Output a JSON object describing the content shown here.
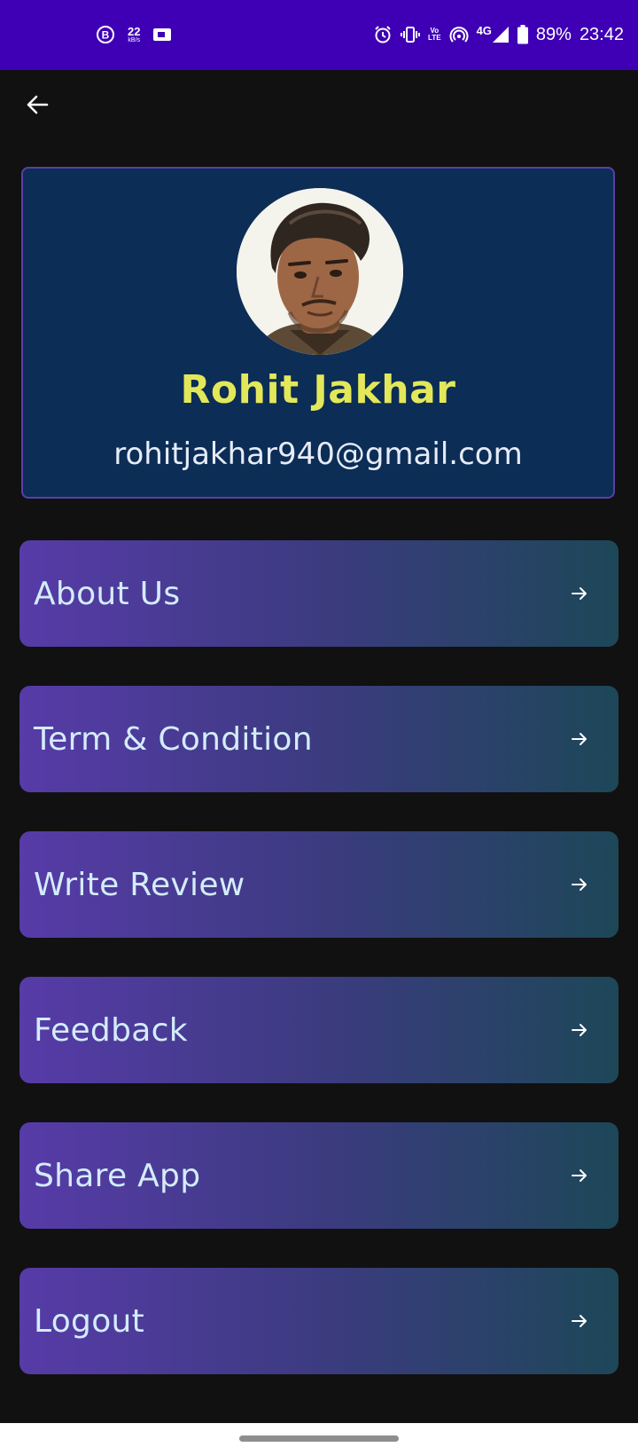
{
  "status_bar": {
    "bg_color": "#3f00b5",
    "left_icons": [
      "b-circle-icon",
      "speed-readout",
      "screen-cast-icon"
    ],
    "speed_value": "22",
    "speed_unit": "kB/s",
    "right_icons": [
      "alarm-icon",
      "vibrate-icon",
      "volte-icon",
      "hotspot-icon",
      "signal-icon",
      "battery-icon"
    ],
    "volte_top": "Vo",
    "volte_bottom": "LTE",
    "network_type": "4G",
    "battery_percent": "89%",
    "time": "23:42"
  },
  "top_bar": {
    "back_icon": "arrow-left-icon"
  },
  "profile": {
    "name": "Rohit Jakhar",
    "email": "rohitjakhar940@gmail.com",
    "card_color": "#0c2d55",
    "border_color": "#5b3ea8",
    "name_color": "#e3e85a"
  },
  "menu": {
    "items": [
      {
        "label": "About Us"
      },
      {
        "label": "Term & Condition"
      },
      {
        "label": "Write Review"
      },
      {
        "label": "Feedback"
      },
      {
        "label": "Share App"
      },
      {
        "label": "Logout"
      }
    ],
    "arrow_icon": "arrow-right-icon",
    "gradient": [
      "#573ba8",
      "#3c3b80",
      "#1d4758"
    ],
    "label_color": "#d3ecfb"
  },
  "nav_bar": {
    "handle": "gesture-handle"
  }
}
